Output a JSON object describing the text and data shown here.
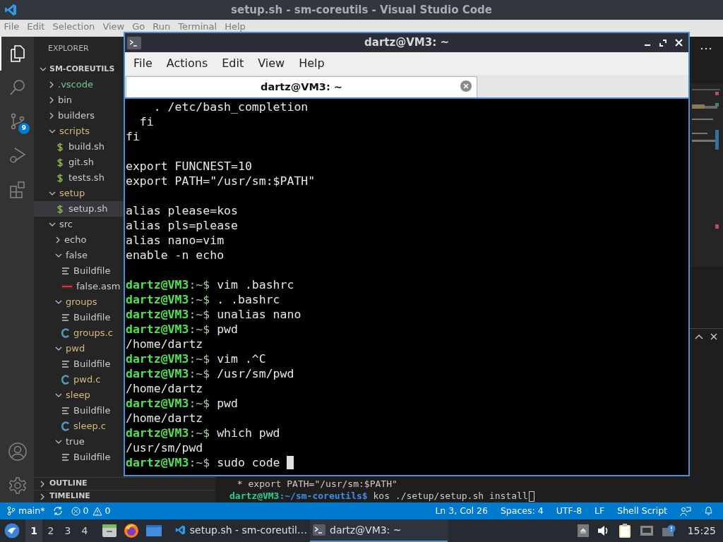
{
  "vscode": {
    "title": "setup.sh - sm-coreutils - Visual Studio Code",
    "menu": [
      "File",
      "Edit",
      "Selection",
      "View",
      "Go",
      "Run",
      "Terminal",
      "Help"
    ],
    "activity_bar": [
      {
        "kind": "explorer",
        "selected": true
      },
      {
        "kind": "search",
        "selected": false
      },
      {
        "kind": "source_control",
        "selected": false,
        "badge": "9"
      },
      {
        "kind": "debug",
        "selected": false
      },
      {
        "kind": "extensions",
        "selected": false
      },
      {
        "kind": "account",
        "selected": false
      },
      {
        "kind": "settings",
        "selected": false
      }
    ],
    "sidebar": {
      "title": "EXPLORER",
      "root": {
        "label": "SM-COREUTILS",
        "expanded": true,
        "children": [
          {
            "label": ".vscode",
            "kind": "folder",
            "expanded": false,
            "selected": false,
            "color": "#73c991"
          },
          {
            "label": "bin",
            "kind": "folder",
            "expanded": false,
            "selected": false
          },
          {
            "label": "builders",
            "kind": "folder",
            "expanded": false,
            "selected": false
          },
          {
            "label": "scripts",
            "kind": "folder",
            "expanded": true,
            "selected": false,
            "color": "#d7ba7d",
            "children": [
              {
                "label": "build.sh",
                "kind": "shell",
                "selected": false
              },
              {
                "label": "git.sh",
                "kind": "shell",
                "selected": false
              },
              {
                "label": "tests.sh",
                "kind": "shell",
                "selected": false
              }
            ]
          },
          {
            "label": "setup",
            "kind": "folder",
            "expanded": true,
            "selected": false,
            "color": "#d7ba7d",
            "children": [
              {
                "label": "setup.sh",
                "kind": "shell",
                "selected": true
              }
            ]
          },
          {
            "label": "src",
            "kind": "folder",
            "expanded": true,
            "selected": false,
            "children": [
              {
                "label": "echo",
                "kind": "folder",
                "expanded": false,
                "selected": false
              },
              {
                "label": "false",
                "kind": "folder",
                "expanded": true,
                "selected": false,
                "children": [
                  {
                    "label": "Buildfile",
                    "kind": "buildfile",
                    "selected": false
                  },
                  {
                    "label": "false.asm",
                    "kind": "asm",
                    "selected": false
                  }
                ]
              },
              {
                "label": "groups",
                "kind": "folder",
                "expanded": true,
                "selected": false,
                "color": "#d7ba7d",
                "children": [
                  {
                    "label": "Buildfile",
                    "kind": "buildfile",
                    "selected": false
                  },
                  {
                    "label": "groups.c",
                    "kind": "c",
                    "selected": false,
                    "color": "#d7ba7d"
                  }
                ]
              },
              {
                "label": "pwd",
                "kind": "folder",
                "expanded": true,
                "selected": false,
                "color": "#d7ba7d",
                "children": [
                  {
                    "label": "Buildfile",
                    "kind": "buildfile",
                    "selected": false
                  },
                  {
                    "label": "pwd.c",
                    "kind": "c",
                    "selected": false,
                    "color": "#d7ba7d"
                  }
                ]
              },
              {
                "label": "sleep",
                "kind": "folder",
                "expanded": true,
                "selected": false,
                "color": "#d7ba7d",
                "children": [
                  {
                    "label": "Buildfile",
                    "kind": "buildfile",
                    "selected": false
                  },
                  {
                    "label": "sleep.c",
                    "kind": "c",
                    "selected": false,
                    "color": "#d7ba7d"
                  }
                ]
              },
              {
                "label": "true",
                "kind": "folder",
                "expanded": true,
                "selected": false,
                "children": [
                  {
                    "label": "Buildfile",
                    "kind": "buildfile",
                    "selected": false
                  }
                ]
              }
            ]
          }
        ]
      },
      "sections": [
        {
          "label": "OUTLINE",
          "expanded": false
        },
        {
          "label": "TIMELINE",
          "expanded": false
        }
      ]
    },
    "panel_terminal": {
      "lines": [
        {
          "kind": "output",
          "text": " * export PATH=\"/usr/sm:$PATH\""
        },
        {
          "kind": "prompt",
          "user": "dartz@VM3",
          "cwd": ":~/sm-coreutils$",
          "command": "kos ./setup/setup.sh install",
          "cursor": true
        }
      ]
    },
    "status_bar": {
      "branch": "main*",
      "errors": "0",
      "warnings": "0",
      "items": [
        "Ln 3, Col 26",
        "Spaces: 4",
        "UTF-8",
        "LF",
        "Shell Script"
      ]
    }
  },
  "terminal_window": {
    "title": "dartz@VM3: ~",
    "menu": [
      "File",
      "Actions",
      "Edit",
      "View",
      "Help"
    ],
    "tabs": [
      {
        "label": "dartz@VM3: ~",
        "selected": true
      }
    ],
    "lines": [
      {
        "kind": "output",
        "text": "    . /etc/bash_completion"
      },
      {
        "kind": "output",
        "text": "  fi"
      },
      {
        "kind": "output",
        "text": "fi"
      },
      {
        "kind": "blank"
      },
      {
        "kind": "output",
        "text": "export FUNCNEST=10"
      },
      {
        "kind": "output",
        "text": "export PATH=\"/usr/sm:$PATH\""
      },
      {
        "kind": "blank"
      },
      {
        "kind": "output",
        "text": "alias please=kos"
      },
      {
        "kind": "output",
        "text": "alias pls=please"
      },
      {
        "kind": "output",
        "text": "alias nano=vim"
      },
      {
        "kind": "output",
        "text": "enable -n echo"
      },
      {
        "kind": "blank"
      },
      {
        "kind": "prompt",
        "user": "dartz@VM3",
        "cwd": ":~$",
        "command": "vim .bashrc"
      },
      {
        "kind": "prompt",
        "user": "dartz@VM3",
        "cwd": ":~$",
        "command": ". .bashrc"
      },
      {
        "kind": "prompt",
        "user": "dartz@VM3",
        "cwd": ":~$",
        "command": "unalias nano"
      },
      {
        "kind": "prompt",
        "user": "dartz@VM3",
        "cwd": ":~$",
        "command": "pwd"
      },
      {
        "kind": "output",
        "text": "/home/dartz"
      },
      {
        "kind": "prompt",
        "user": "dartz@VM3",
        "cwd": ":~$",
        "command": "vim .^C"
      },
      {
        "kind": "prompt",
        "user": "dartz@VM3",
        "cwd": ":~$",
        "command": "/usr/sm/pwd"
      },
      {
        "kind": "output",
        "text": "/home/dartz"
      },
      {
        "kind": "prompt",
        "user": "dartz@VM3",
        "cwd": ":~$",
        "command": "pwd"
      },
      {
        "kind": "output",
        "text": "/home/dartz"
      },
      {
        "kind": "prompt",
        "user": "dartz@VM3",
        "cwd": ":~$",
        "command": "which pwd"
      },
      {
        "kind": "output",
        "text": "/usr/sm/pwd"
      },
      {
        "kind": "prompt",
        "user": "dartz@VM3",
        "cwd": ":~$",
        "command": "sudo code",
        "cursor": true
      }
    ]
  },
  "taskbar": {
    "workspaces": [
      {
        "label": "1",
        "selected": true
      },
      {
        "label": "2",
        "selected": false
      },
      {
        "label": "3",
        "selected": false
      },
      {
        "label": "4",
        "selected": false
      }
    ],
    "launchers": [
      {
        "kind": "files"
      },
      {
        "kind": "browser"
      },
      {
        "kind": "window"
      }
    ],
    "tasks": [
      {
        "kind": "vscode",
        "label": "setup.sh - sm-coreutil…",
        "selected": false
      },
      {
        "kind": "terminal",
        "label": "dartz@VM3: ~",
        "selected": true
      }
    ],
    "tray": [
      {
        "kind": "up"
      },
      {
        "kind": "volume"
      },
      {
        "kind": "clipboard"
      },
      {
        "kind": "network"
      },
      {
        "kind": "notification"
      }
    ],
    "clock": "15:25"
  }
}
